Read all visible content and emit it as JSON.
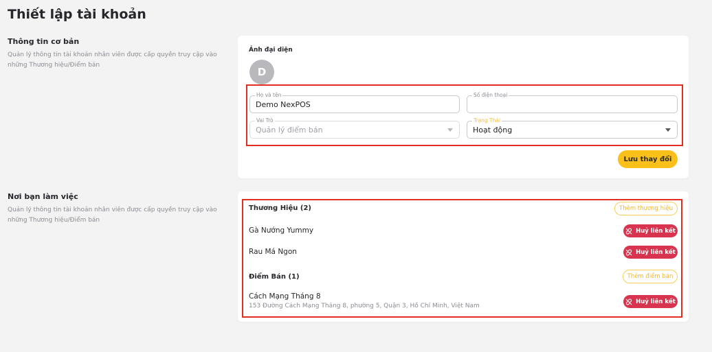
{
  "page": {
    "title": "Thiết lập tài khoản"
  },
  "basic": {
    "heading": "Thông tin cơ bản",
    "description": "Quản lý thông tin tài khoản nhân viên được cấp quyền truy cập vào những Thương hiệu/Điểm bán",
    "avatar_label": "Ảnh đại diện",
    "avatar_initial": "D",
    "fields": {
      "name": {
        "label": "Họ và tên",
        "value": "Demo NexPOS"
      },
      "phone": {
        "label": "Số điện thoại",
        "value": ""
      },
      "role": {
        "label": "Vai Trò",
        "value": "Quản lý điểm bán"
      },
      "status": {
        "label": "Trạng Thái",
        "value": "Hoạt động"
      }
    },
    "save_label": "Lưu thay đổi"
  },
  "workplace": {
    "heading": "Nơi bạn làm việc",
    "description": "Quản lý thông tin tài khoản nhân viên được cấp quyền truy cập vào những Thương hiệu/Điểm bán",
    "brands": {
      "title": "Thương Hiệu (2)",
      "add_label": "Thêm thương hiệu",
      "items": [
        {
          "name": "Gà Nướng Yummy",
          "unlink_label": "Huỷ liên kết"
        },
        {
          "name": "Rau Má Ngon",
          "unlink_label": "Huỷ liên kết"
        }
      ]
    },
    "stores": {
      "title": "Điểm Bán (1)",
      "add_label": "Thêm điểm bán",
      "items": [
        {
          "name": "Cách Mạng Tháng 8",
          "address": "153 Đường Cách Mạng Tháng 8, phường 5, Quận 3, Hồ Chí Minh, Việt Nam",
          "unlink_label": "Huỷ liên kết"
        }
      ]
    }
  },
  "colors": {
    "accent": "#fcc01a",
    "danger": "#d9344f",
    "highlight": "#e22d1f"
  }
}
